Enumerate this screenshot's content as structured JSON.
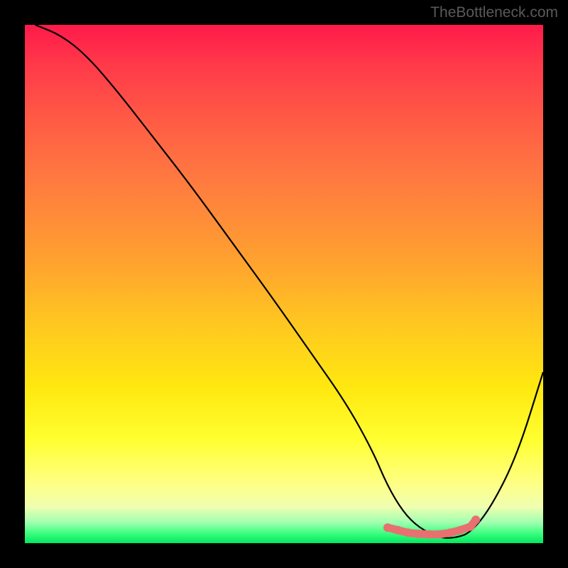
{
  "watermark": "TheBottleneck.com",
  "chart_data": {
    "type": "line",
    "title": "",
    "xlabel": "",
    "ylabel": "",
    "xlim": [
      0,
      100
    ],
    "ylim": [
      0,
      100
    ],
    "series": [
      {
        "name": "curve",
        "x": [
          2,
          7,
          12,
          18,
          25,
          32,
          40,
          48,
          55,
          62,
          67,
          70,
          73,
          76,
          80,
          83,
          86,
          90,
          95,
          100
        ],
        "y": [
          100,
          98,
          94,
          87,
          78,
          69,
          58,
          47,
          37,
          27,
          18,
          11,
          6,
          3,
          1,
          1,
          2,
          7,
          17,
          33
        ]
      }
    ],
    "markers": {
      "name": "highlight-dots",
      "color": "#e87070",
      "x": [
        70,
        72,
        74,
        76,
        78,
        80,
        82,
        84,
        86,
        87
      ],
      "y": [
        3,
        2.5,
        2,
        1.8,
        1.7,
        1.7,
        2,
        2.5,
        3.2,
        4.5
      ]
    },
    "gradient_stops": [
      {
        "pos": 0,
        "color": "#ff1a4a"
      },
      {
        "pos": 0.5,
        "color": "#ffc820"
      },
      {
        "pos": 0.85,
        "color": "#ffff60"
      },
      {
        "pos": 1,
        "color": "#00e860"
      }
    ]
  }
}
